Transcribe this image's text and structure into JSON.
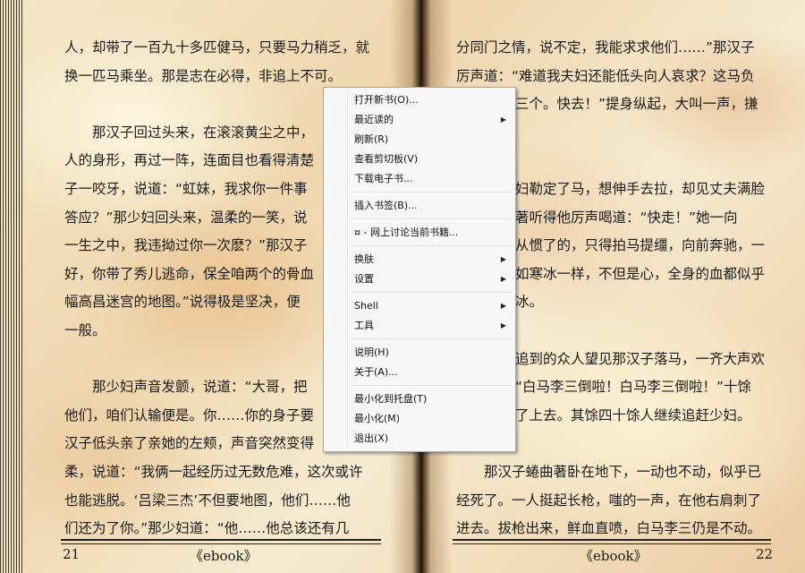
{
  "left_page": {
    "lines": [
      "人，却带了一百九十多匹健马，只要马力稍乏，就",
      "换一匹马乘坐。那是志在必得，非追上不可。",
      "",
      "　　那汉子回过头来，在滚滚黄尘之中，",
      "人的身形，再过一阵，连面目也看得清楚",
      "子一咬牙，说道：“虹妹，我求你一件事",
      "答应？”那少妇回头来，温柔的一笑，说",
      "一生之中，我违拗过你一次麽？”那汉子",
      "好，你带了秀儿逃命，保全咱两个的骨血",
      "幅高昌迷宫的地图。”说得极是坚决，便",
      "一般。",
      "",
      "　　那少妇声音发颤，说道：“大哥，把",
      "他们，咱们认输便是。你……你的身子要",
      "汉子低头亲了亲她的左颊，声音突然变得",
      "柔，说道：“我俩一起经历过无数危难，这次或许",
      "也能逃脱。‘吕梁三杰’不但要地图，他们……他",
      "们还为了你。”那少妇道：“他……他总该还有几"
    ],
    "page_number": "21",
    "book_title": "《ebook》"
  },
  "right_page": {
    "lines": [
      "分同门之情，说不定，我能求求他们……”那汉子",
      "厉声道：“难道我夫妇还能低头向人哀求？这马负",
      "三个。快去！”提身纵起，大叫一声，搛",
      "",
      "",
      "妇勒定了马，想伸手去拉，却见丈夫满脸",
      "著听得他厉声喝道：“快走！”她一向",
      "从惯了的，只得拍马提缰，向前奔驰，一",
      "如寒冰一样，不但是心，全身的血都似乎",
      "冰。",
      "",
      "追到的众人望见那汉子落马，一齐大声欢",
      "“白马李三倒啦！白马李三倒啦！”十馀",
      "了上去。其馀四十馀人继续追赶少妇。",
      "",
      "　　那汉子蜷曲著卧在地下，一动也不动，似乎已",
      "经死了。一人挺起长枪，嗤的一声，在他右肩刺了",
      "进去。拔枪出来，鲜血直喷，白马李三仍是不动。"
    ],
    "page_number": "22",
    "book_title": "《ebook》"
  },
  "context_menu": {
    "items": [
      {
        "label": "打开新书(O)...",
        "submenu": false
      },
      {
        "label": "最近读的",
        "submenu": true
      },
      {
        "label": "刷新(R)",
        "submenu": false
      },
      {
        "label": "查看剪切板(V)",
        "submenu": false
      },
      {
        "label": "下载电子书...",
        "submenu": false
      },
      {
        "label": "插入书签(B)...",
        "submenu": false
      },
      {
        "label": "¤ - 网上讨论当前书籍...",
        "submenu": false
      },
      {
        "label": "换肤",
        "submenu": true
      },
      {
        "label": "设置",
        "submenu": true
      },
      {
        "label": "Shell",
        "submenu": true
      },
      {
        "label": "工具",
        "submenu": true
      },
      {
        "label": "说明(H)",
        "submenu": false
      },
      {
        "label": "关于(A)...",
        "submenu": false
      },
      {
        "label": "最小化到托盘(T)",
        "submenu": false
      },
      {
        "label": "最小化(M)",
        "submenu": false
      },
      {
        "label": "退出(X)",
        "submenu": false
      }
    ],
    "submenu_arrow": "▶"
  }
}
